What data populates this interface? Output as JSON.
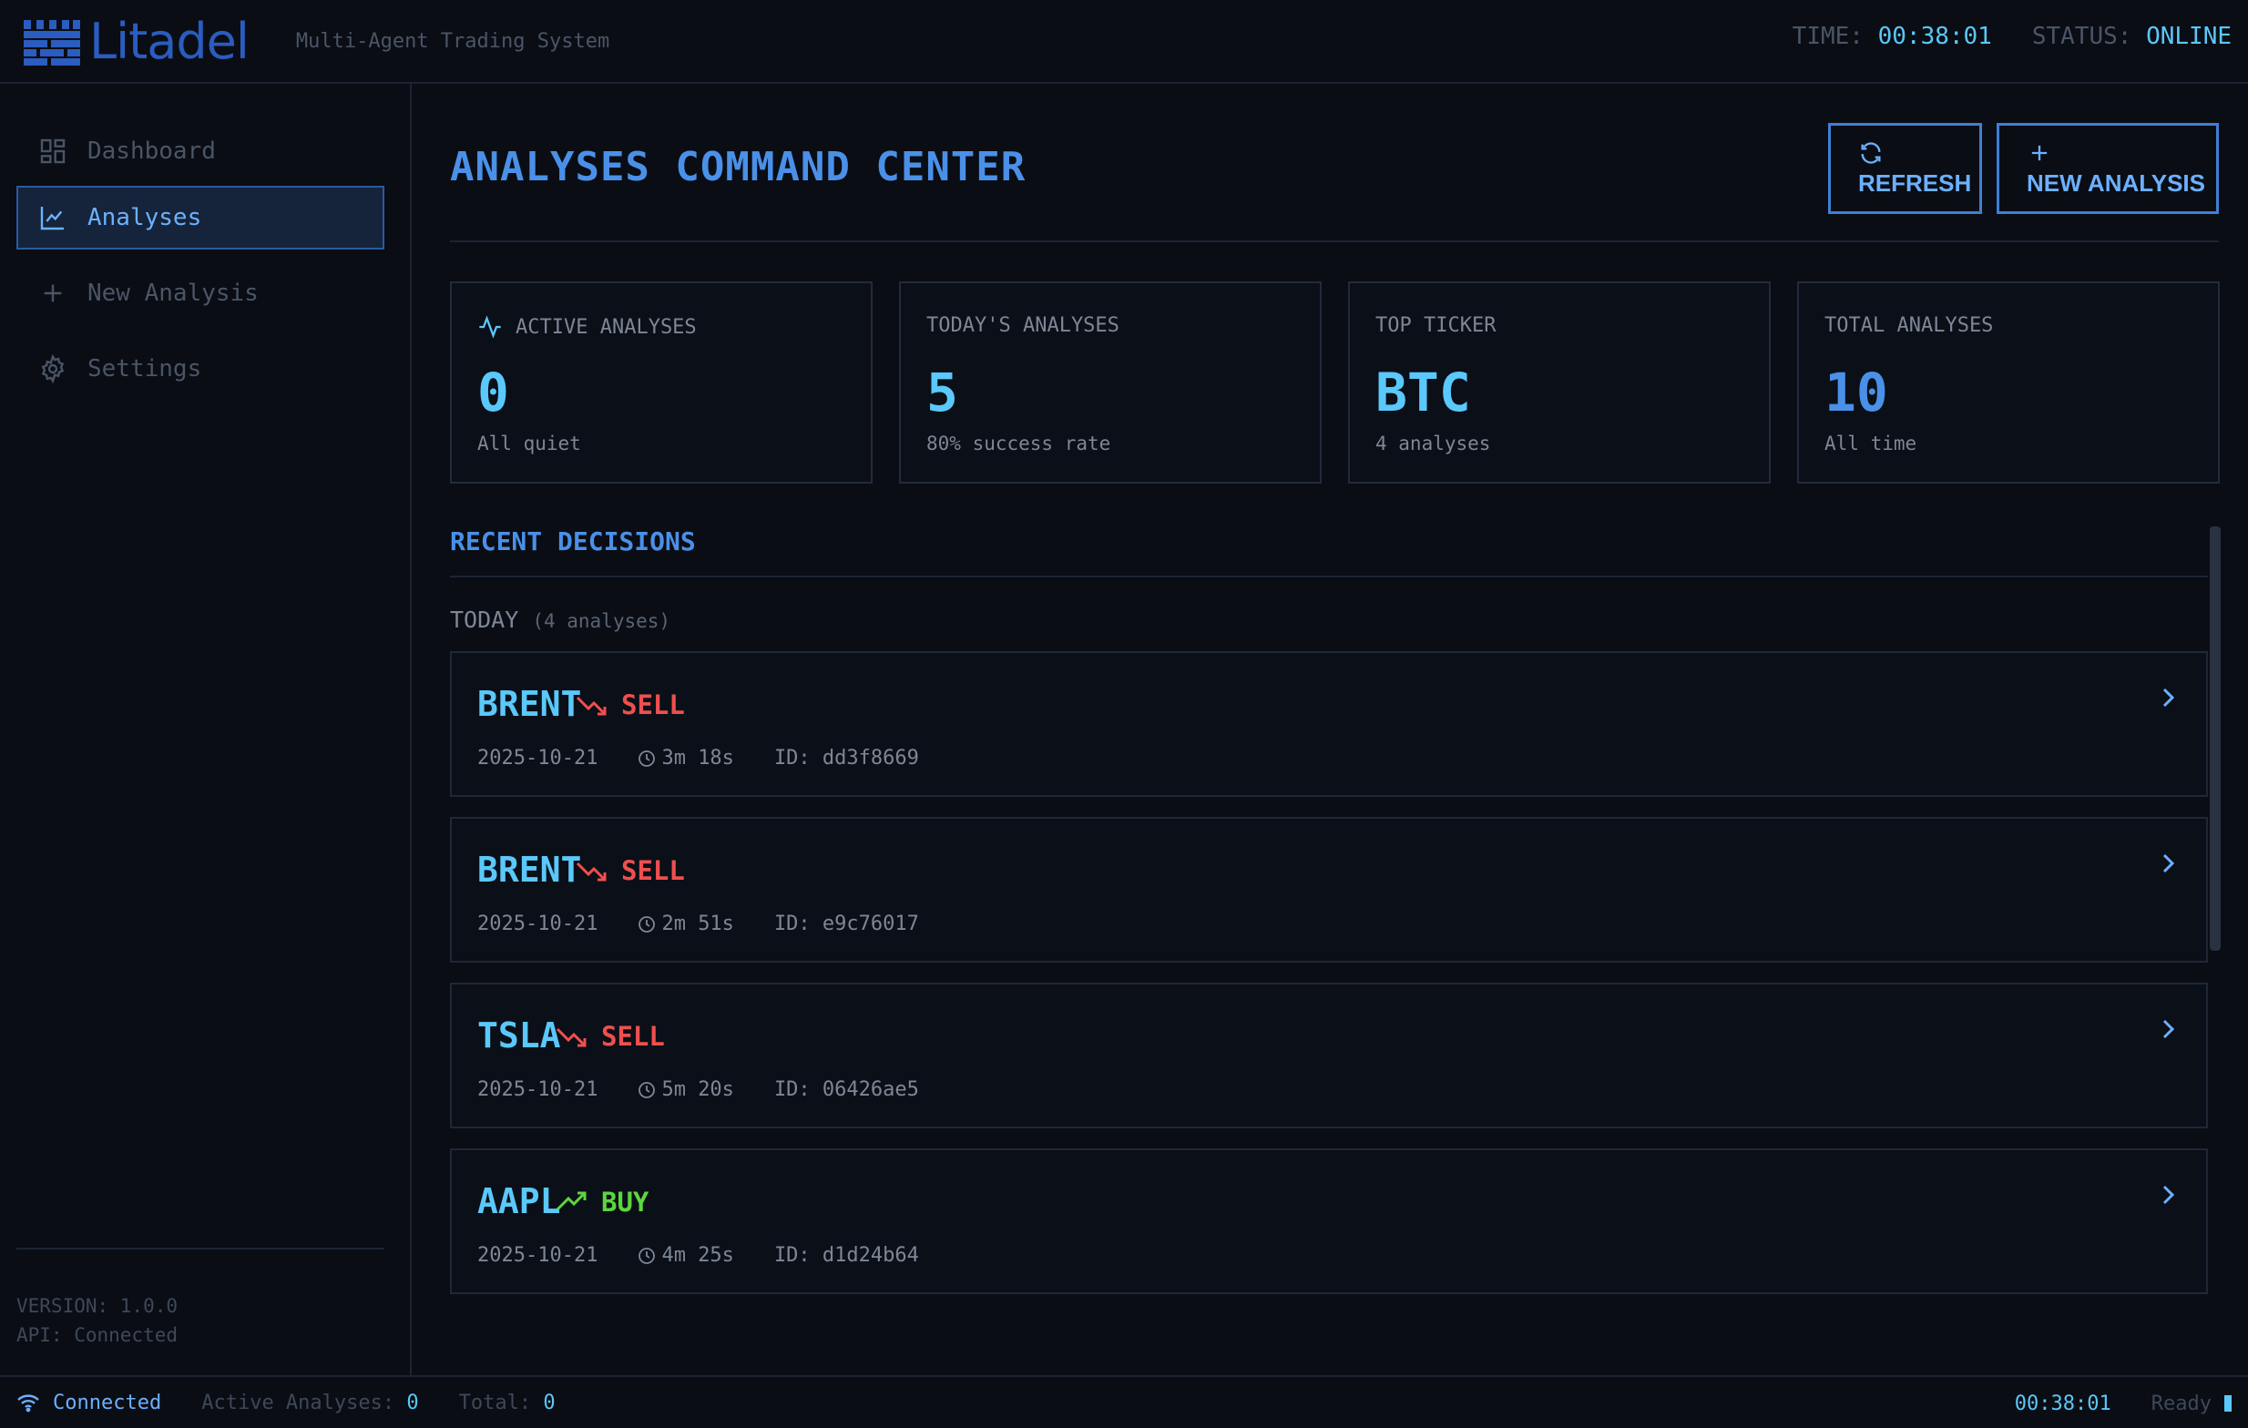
{
  "app": {
    "name": "Litadel",
    "tagline": "Multi-Agent Trading System"
  },
  "header": {
    "time_label": "TIME:",
    "time_value": "00:38:01",
    "status_label": "STATUS:",
    "status_value": "ONLINE"
  },
  "sidebar": {
    "items": [
      {
        "label": "Dashboard",
        "icon": "dashboard-icon",
        "active": false
      },
      {
        "label": "Analyses",
        "icon": "chart-line-icon",
        "active": true
      },
      {
        "label": "New Analysis",
        "icon": "plus-icon",
        "active": false
      },
      {
        "label": "Settings",
        "icon": "gear-icon",
        "active": false
      }
    ],
    "version": "VERSION: 1.0.0",
    "api": "API: Connected"
  },
  "main": {
    "title": "ANALYSES COMMAND CENTER",
    "refresh_label": "REFRESH",
    "new_analysis_label": "NEW ANALYSIS",
    "stats": [
      {
        "label": "ACTIVE ANALYSES",
        "value": "0",
        "sub": "All quiet",
        "color": "#5ac8fa",
        "icon": "activity-icon"
      },
      {
        "label": "TODAY'S ANALYSES",
        "value": "5",
        "sub": "80% success rate",
        "color": "#5ac8fa"
      },
      {
        "label": "TOP TICKER",
        "value": "BTC",
        "sub": "4 analyses",
        "color": "#5ac8fa"
      },
      {
        "label": "TOTAL ANALYSES",
        "value": "10",
        "sub": "All time",
        "color": "#4a90e8"
      }
    ],
    "recent_title": "RECENT DECISIONS",
    "group": {
      "label": "TODAY",
      "count": "(4 analyses)"
    },
    "decisions": [
      {
        "ticker": "BRENT",
        "signal": "SELL",
        "date": "2025-10-21",
        "duration": "3m 18s",
        "id": "ID: dd3f8669"
      },
      {
        "ticker": "BRENT",
        "signal": "SELL",
        "date": "2025-10-21",
        "duration": "2m 51s",
        "id": "ID: e9c76017"
      },
      {
        "ticker": "TSLA",
        "signal": "SELL",
        "date": "2025-10-21",
        "duration": "5m 20s",
        "id": "ID: 06426ae5"
      },
      {
        "ticker": "AAPL",
        "signal": "BUY",
        "date": "2025-10-21",
        "duration": "4m 25s",
        "id": "ID: d1d24b64"
      }
    ]
  },
  "statusbar": {
    "connection": "Connected",
    "active_label": "Active Analyses:",
    "active_value": "0",
    "total_label": "Total:",
    "total_value": "0",
    "time": "00:38:01",
    "ready": "Ready"
  },
  "colors": {
    "accent": "#4a90e8",
    "cyan": "#5ac8fa",
    "sell": "#ef4f4f",
    "buy": "#5cd63e",
    "background": "#0a0d14"
  }
}
